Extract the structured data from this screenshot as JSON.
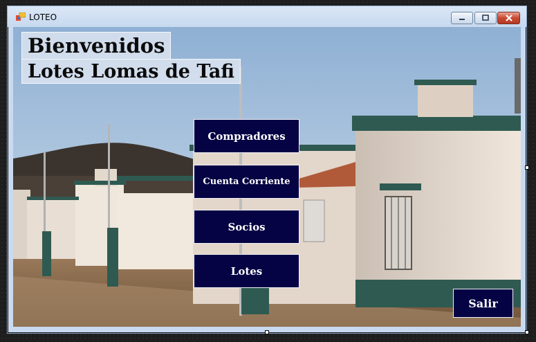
{
  "window": {
    "title": "LOTEO",
    "icon": "app-form-icon",
    "controls": {
      "minimize": "minimize-icon",
      "maximize": "maximize-icon",
      "close": "close-icon"
    }
  },
  "headings": {
    "welcome": "Bienvenidos",
    "subtitle": "Lotes Lomas de Tafi"
  },
  "menu": {
    "compradores": "Compradores",
    "cuenta_corriente": "Cuenta Corriente",
    "socios": "Socios",
    "lotes": "Lotes"
  },
  "exit": {
    "label": "Salir"
  },
  "colors": {
    "button_bg": "#060344",
    "button_text": "#ffffff",
    "titlebar": "#c7d9ef"
  }
}
